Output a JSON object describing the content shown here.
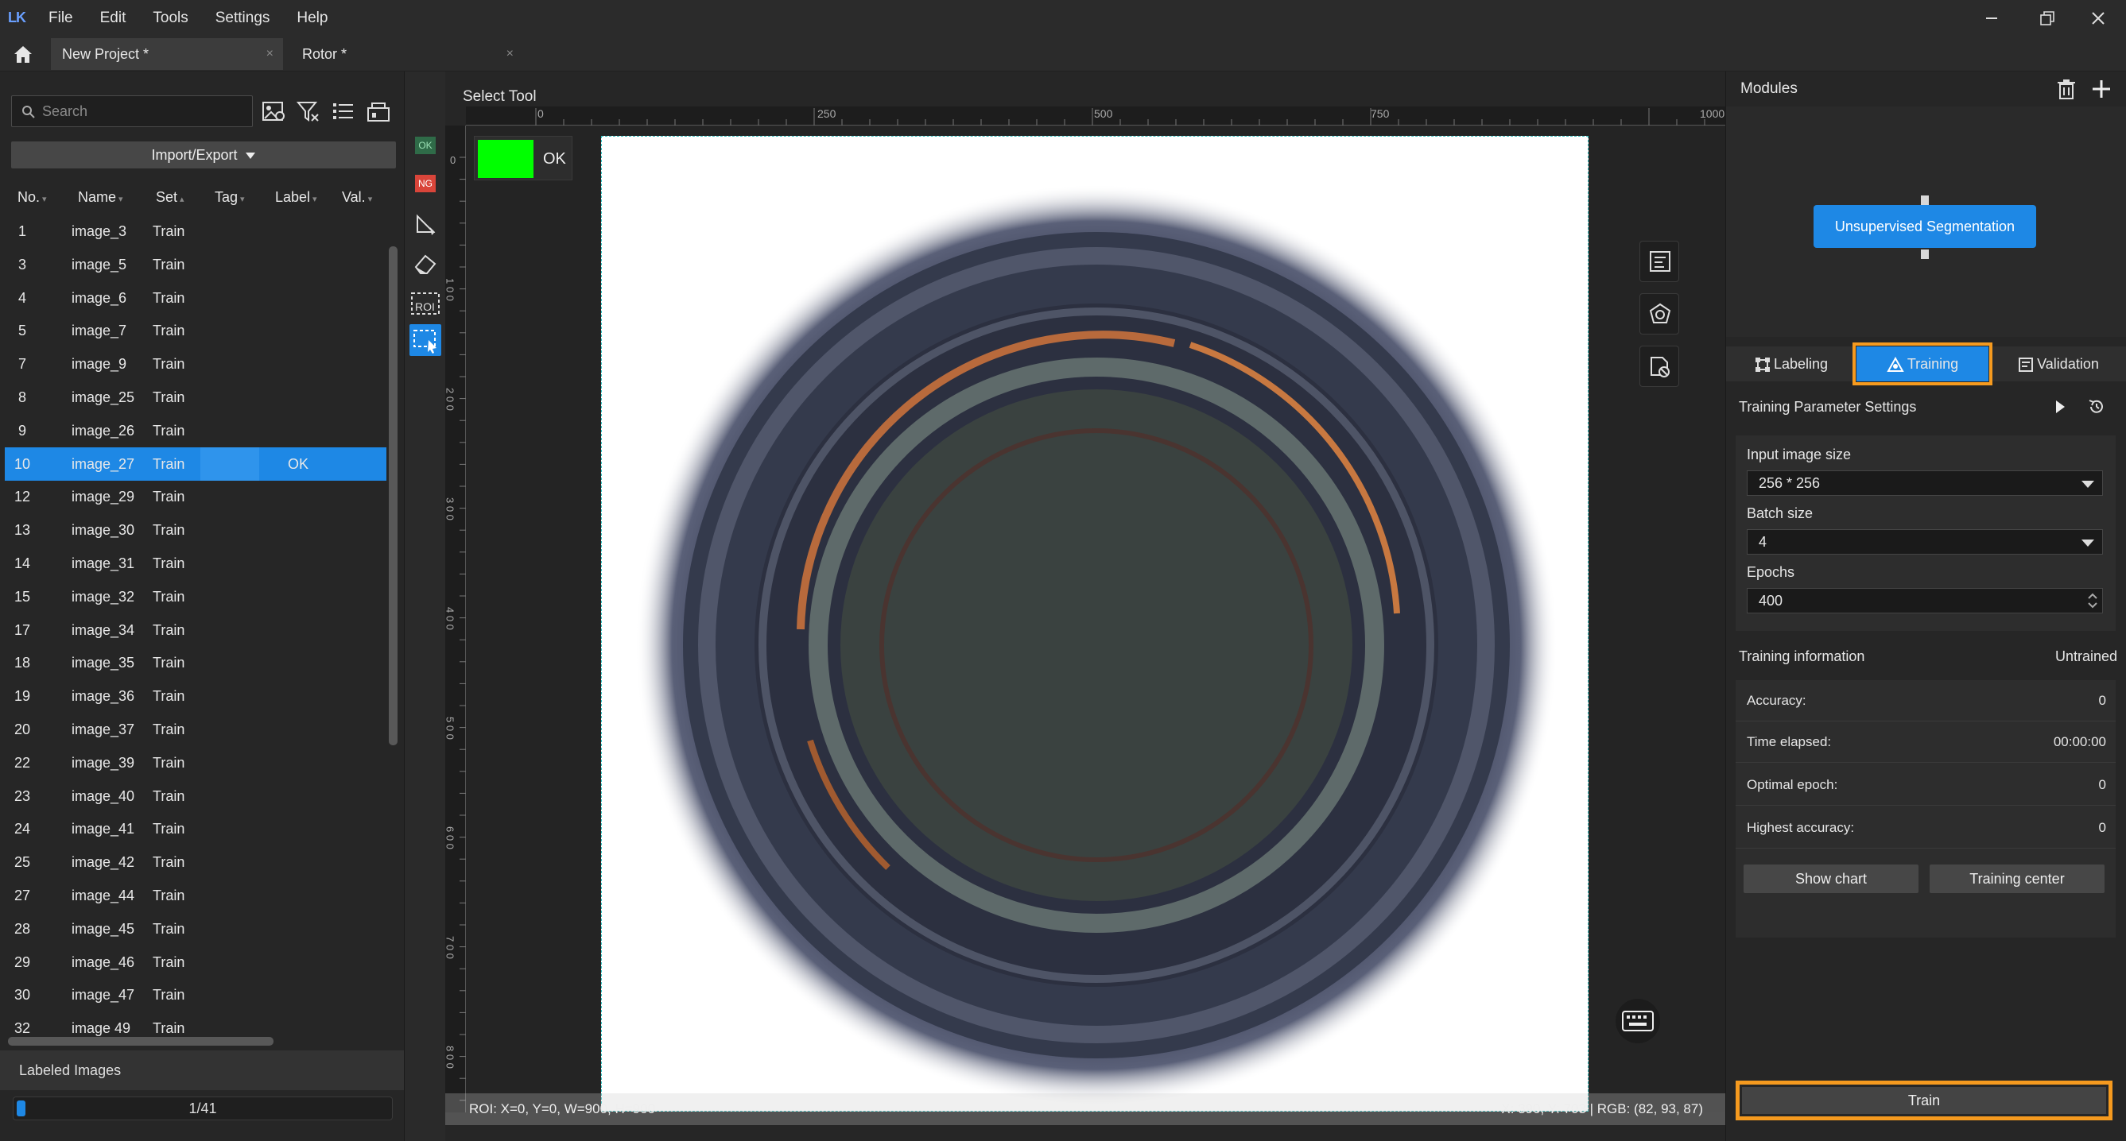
{
  "app": {
    "logo_text": "LK",
    "menu": [
      "File",
      "Edit",
      "Tools",
      "Settings",
      "Help"
    ]
  },
  "tabs": [
    {
      "label": "New Project *",
      "close": "×"
    },
    {
      "label": "Rotor *",
      "close": "×"
    }
  ],
  "left": {
    "search_placeholder": "Search",
    "import_export": "Import/Export",
    "columns": [
      "No.",
      "Name",
      "Set",
      "Tag",
      "Label",
      "Val."
    ],
    "rows": [
      {
        "no": "1",
        "name": "image_3",
        "set": "Train",
        "label": ""
      },
      {
        "no": "3",
        "name": "image_5",
        "set": "Train",
        "label": ""
      },
      {
        "no": "4",
        "name": "image_6",
        "set": "Train",
        "label": ""
      },
      {
        "no": "5",
        "name": "image_7",
        "set": "Train",
        "label": ""
      },
      {
        "no": "7",
        "name": "image_9",
        "set": "Train",
        "label": ""
      },
      {
        "no": "8",
        "name": "image_25",
        "set": "Train",
        "label": ""
      },
      {
        "no": "9",
        "name": "image_26",
        "set": "Train",
        "label": ""
      },
      {
        "no": "10",
        "name": "image_27",
        "set": "Train",
        "label": "OK",
        "selected": true
      },
      {
        "no": "12",
        "name": "image_29",
        "set": "Train",
        "label": ""
      },
      {
        "no": "13",
        "name": "image_30",
        "set": "Train",
        "label": ""
      },
      {
        "no": "14",
        "name": "image_31",
        "set": "Train",
        "label": ""
      },
      {
        "no": "15",
        "name": "image_32",
        "set": "Train",
        "label": ""
      },
      {
        "no": "17",
        "name": "image_34",
        "set": "Train",
        "label": ""
      },
      {
        "no": "18",
        "name": "image_35",
        "set": "Train",
        "label": ""
      },
      {
        "no": "19",
        "name": "image_36",
        "set": "Train",
        "label": ""
      },
      {
        "no": "20",
        "name": "image_37",
        "set": "Train",
        "label": ""
      },
      {
        "no": "22",
        "name": "image_39",
        "set": "Train",
        "label": ""
      },
      {
        "no": "23",
        "name": "image_40",
        "set": "Train",
        "label": ""
      },
      {
        "no": "24",
        "name": "image_41",
        "set": "Train",
        "label": ""
      },
      {
        "no": "25",
        "name": "image_42",
        "set": "Train",
        "label": ""
      },
      {
        "no": "27",
        "name": "image_44",
        "set": "Train",
        "label": ""
      },
      {
        "no": "28",
        "name": "image_45",
        "set": "Train",
        "label": ""
      },
      {
        "no": "29",
        "name": "image_46",
        "set": "Train",
        "label": ""
      },
      {
        "no": "30",
        "name": "image_47",
        "set": "Train",
        "label": ""
      },
      {
        "no": "32",
        "name": "image 49",
        "set": "Train",
        "label": ""
      }
    ],
    "labeled_images": "Labeled Images",
    "progress_text": "1/41",
    "progress_fraction": 0.024
  },
  "tools": {
    "ok_label": "OK",
    "ng_label": "NG",
    "roi_label": "ROI"
  },
  "center": {
    "title": "Select Tool",
    "ruler_top": [
      "0",
      "250",
      "500",
      "750",
      "1000"
    ],
    "ruler_left": [
      "0",
      "1 0 0",
      "2 0 0",
      "3 0 0",
      "4 0 0",
      "5 0 0",
      "6 0 0",
      "7 0 0",
      "8 0 0"
    ],
    "image_label": "OK",
    "status_left": "ROI: X=0, Y=0, W=900, H=900",
    "status_right": "X: 390, Y: 703 | RGB: (82, 93, 87)"
  },
  "right": {
    "modules_title": "Modules",
    "module_node": "Unsupervised Segmentation",
    "tabs": [
      "Labeling",
      "Training",
      "Validation"
    ],
    "training_params_title": "Training Parameter Settings",
    "input_size_label": "Input image size",
    "input_size_value": "256 * 256",
    "batch_label": "Batch size",
    "batch_value": "4",
    "epochs_label": "Epochs",
    "epochs_value": "400",
    "training_info_label": "Training information",
    "training_status": "Untrained",
    "stats": [
      {
        "k": "Accuracy:",
        "v": "0"
      },
      {
        "k": "Time elapsed:",
        "v": "00:00:00"
      },
      {
        "k": "Optimal epoch:",
        "v": "0"
      },
      {
        "k": "Highest accuracy:",
        "v": "0"
      }
    ],
    "show_chart": "Show chart",
    "training_center": "Training center",
    "train_button": "Train"
  },
  "colors": {
    "accent": "#1e88e5",
    "highlight": "#f59a1f",
    "ok_green": "#00ff00",
    "ng_red": "#d9453a"
  }
}
